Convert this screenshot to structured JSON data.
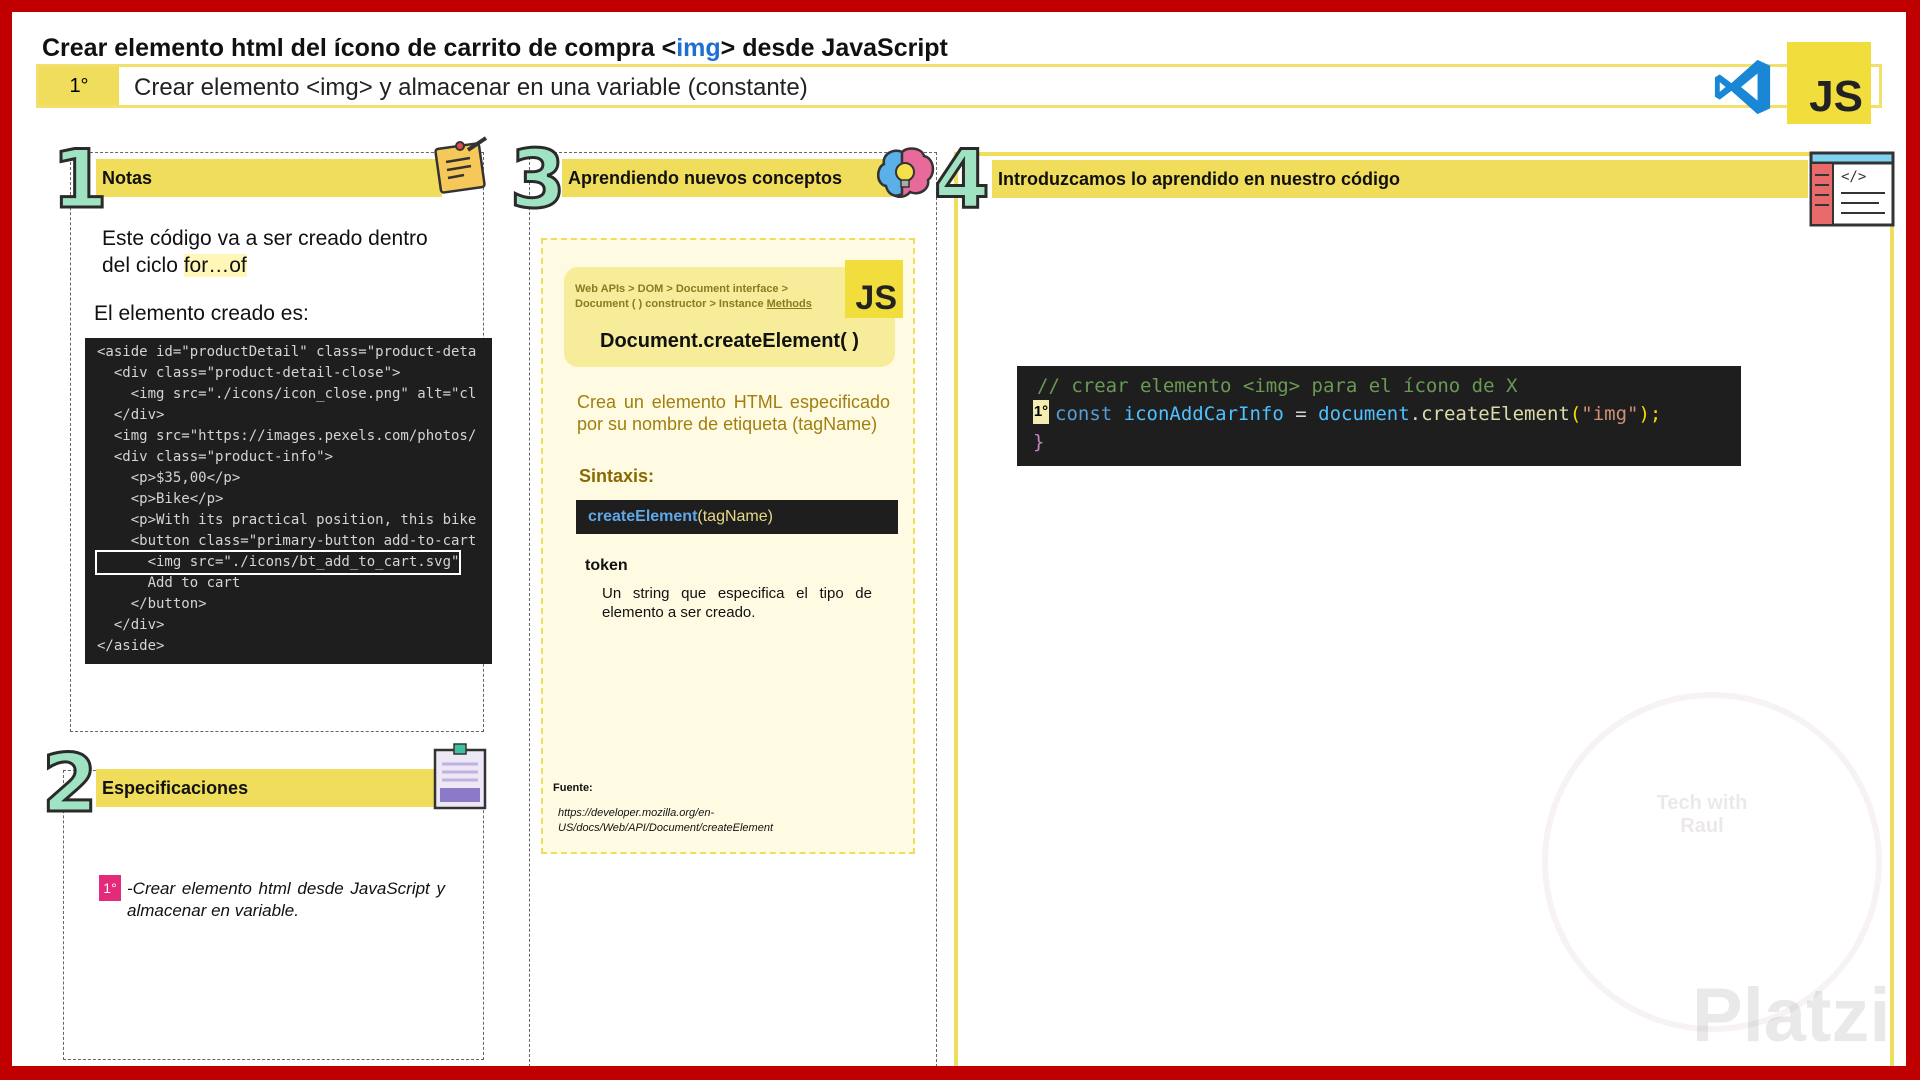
{
  "header": {
    "title_prefix": "Crear elemento html del ícono de carrito de compra <",
    "title_highlight": "img",
    "title_suffix": "> desde JavaScript",
    "step_number": "1°",
    "step_text": "Crear elemento <img> y almacenar en una variable (constante)",
    "js_badge": "JS"
  },
  "panel1": {
    "number": "1",
    "title": "Notas",
    "note_line1": "Este código va a ser creado dentro",
    "note_line2_prefix": "del ciclo ",
    "note_line2_highlight": "for…of",
    "created_label": "El elemento creado es:",
    "code_lines": [
      "<aside id=\"productDetail\" class=\"product-deta",
      "  <div class=\"product-detail-close\">",
      "    <img src=\"./icons/icon_close.png\" alt=\"cl",
      "  </div>",
      "  <img src=\"https://images.pexels.com/photos/",
      "  <div class=\"product-info\">",
      "    <p>$35,00</p>",
      "    <p>Bike</p>",
      "    <p>With its practical position, this bike",
      "    <button class=\"primary-button add-to-cart",
      "      <img src=\"./icons/bt_add_to_cart.svg\"",
      "      Add to cart",
      "    </button>",
      "  </div>",
      "</aside>"
    ]
  },
  "panel2": {
    "number": "2",
    "title": "Especificaciones",
    "badge": "1°",
    "spec_text": "-Crear elemento html desde JavaScript y almacenar en variable."
  },
  "panel3": {
    "number": "3",
    "title": "Aprendiendo nuevos conceptos",
    "crumb_line1": "Web  APIs  >  DOM  >  Document  interface  >",
    "crumb_line2_prefix": "Document ( ) constructor > Instance ",
    "crumb_line2_link": "Methods",
    "js_badge": "JS",
    "method": "Document.createElement( )",
    "description": "Crea un elemento HTML especificado por su nombre de etiqueta (tagName)",
    "syntax_label": "Sintaxis:",
    "syntax_fn": "createElement",
    "syntax_args": "(tagName)",
    "token_label": "token",
    "token_desc": "Un string que especifica el tipo de elemento a ser creado.",
    "source_label": "Fuente:",
    "source_url_line1": "https://developer.mozilla.org/en-",
    "source_url_line2": "US/docs/Web/API/Document/createElement"
  },
  "panel4": {
    "number": "4",
    "title": "Introduzcamos lo aprendido en nuestro código",
    "comment": "// crear elemento <img> para el ícono de X",
    "line_badge": "1°",
    "code_kw": "const",
    "code_var": "iconAddCarInfo",
    "code_eq": " = ",
    "code_obj": "document",
    "code_dot": ".",
    "code_fn": "createElement",
    "code_open": "(",
    "code_str": "\"img\"",
    "code_close": ");",
    "code_brace": "}"
  },
  "watermark": {
    "brand": "Platzi",
    "logo_line1": "Tech with",
    "logo_line2": "Raul"
  },
  "colors": {
    "frame": "#c00000",
    "yellow": "#f1dd5c",
    "mint": "#9fe3c2"
  }
}
